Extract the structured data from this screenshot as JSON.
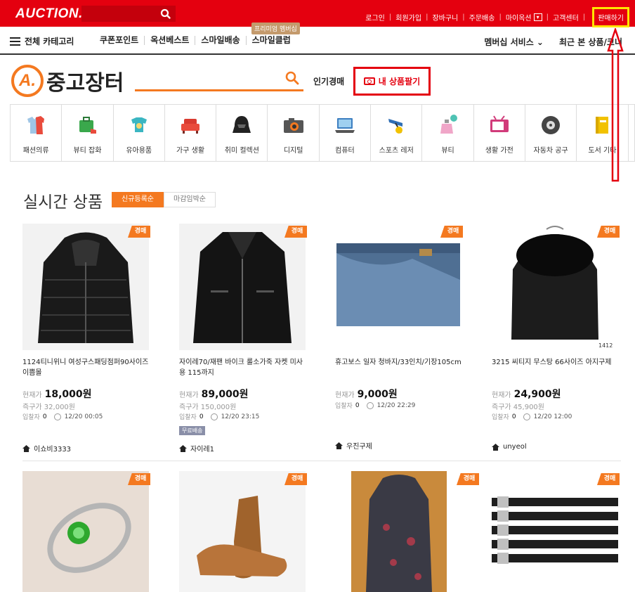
{
  "topbar": {
    "logo": "AUCTION.",
    "links": [
      "로그인",
      "회원가입",
      "장바구니",
      "주문배송",
      "마이옥션",
      "고객센터"
    ],
    "sell_button": "판매하기"
  },
  "nav": {
    "all_categories": "전체 카테고리",
    "links": [
      "쿠폰포인트",
      "옥션베스트",
      "스마일배송",
      "스마일클럽"
    ],
    "premium_tag": "프리미엄 멤버십",
    "membership": "멤버십 서비스",
    "recent": "최근 본 상품/코너"
  },
  "brand": {
    "logo_letter": "A.",
    "title": "중고장터",
    "popular_auction": "인기경매",
    "sell_mine": "내 상품팔기"
  },
  "categories": [
    {
      "label": "패션의류",
      "icon": "clothes-icon",
      "color": "#e94b3c"
    },
    {
      "label": "뷰티 잡화",
      "icon": "bag-icon",
      "color": "#3aa84c"
    },
    {
      "label": "유아용품",
      "icon": "baby-clothes-icon",
      "color": "#3bb6c2"
    },
    {
      "label": "가구 생활",
      "icon": "sofa-icon",
      "color": "#d93b30"
    },
    {
      "label": "취미 컬렉션",
      "icon": "helmet-icon",
      "color": "#222222"
    },
    {
      "label": "디지털",
      "icon": "camera-icon",
      "color": "#555555"
    },
    {
      "label": "컴퓨터",
      "icon": "laptop-icon",
      "color": "#3d7fc1"
    },
    {
      "label": "스포츠 레저",
      "icon": "golf-icon",
      "color": "#2f6fb5"
    },
    {
      "label": "뷰티",
      "icon": "perfume-icon",
      "color": "#4fc3b4"
    },
    {
      "label": "생활 가전",
      "icon": "tv-icon",
      "color": "#d13b7a"
    },
    {
      "label": "자동차 공구",
      "icon": "tire-icon",
      "color": "#444444"
    },
    {
      "label": "도서 기타",
      "icon": "book-icon",
      "color": "#f2c200"
    }
  ],
  "section": {
    "title": "실시간 상품",
    "sort_tabs": [
      "신규등록순",
      "마감임박순"
    ]
  },
  "labels": {
    "badge": "경매",
    "current_price": "현재가",
    "buy_now": "즉구가",
    "bids": "입찰자",
    "free_shipping": "무료배송",
    "image_number": "1412"
  },
  "products": [
    {
      "title": "1124티니위니 여성구스패딩점퍼90사이즈 이쁨몰",
      "price": "18,000원",
      "buy_now": "32,000원",
      "bids": "0",
      "time": "12/20 00:05",
      "seller": "이쇼비3333",
      "free": "",
      "img": "puffer-jacket"
    },
    {
      "title": "자이레70/재팬 바이크 룰소가죽 자켓 미사용 115까지",
      "price": "89,000원",
      "buy_now": "150,000원",
      "bids": "0",
      "time": "12/20 23:15",
      "seller": "자이레1",
      "free": "무료배송",
      "img": "leather-jacket"
    },
    {
      "title": "휴고보스 일자 청바지/33인치/기장105cm",
      "price": "9,000원",
      "buy_now": "",
      "bids": "0",
      "time": "12/20 22:29",
      "seller": "우진구제",
      "free": "",
      "img": "jeans"
    },
    {
      "title": "3215 씨티지 무스탕 66사이즈 아지구제",
      "price": "24,900원",
      "buy_now": "45,900원",
      "bids": "0",
      "time": "12/20 12:00",
      "seller": "unyeol",
      "free": "",
      "img": "fur-coat"
    }
  ],
  "row2_images": [
    "ring",
    "shoes",
    "long-coat",
    "belts"
  ]
}
